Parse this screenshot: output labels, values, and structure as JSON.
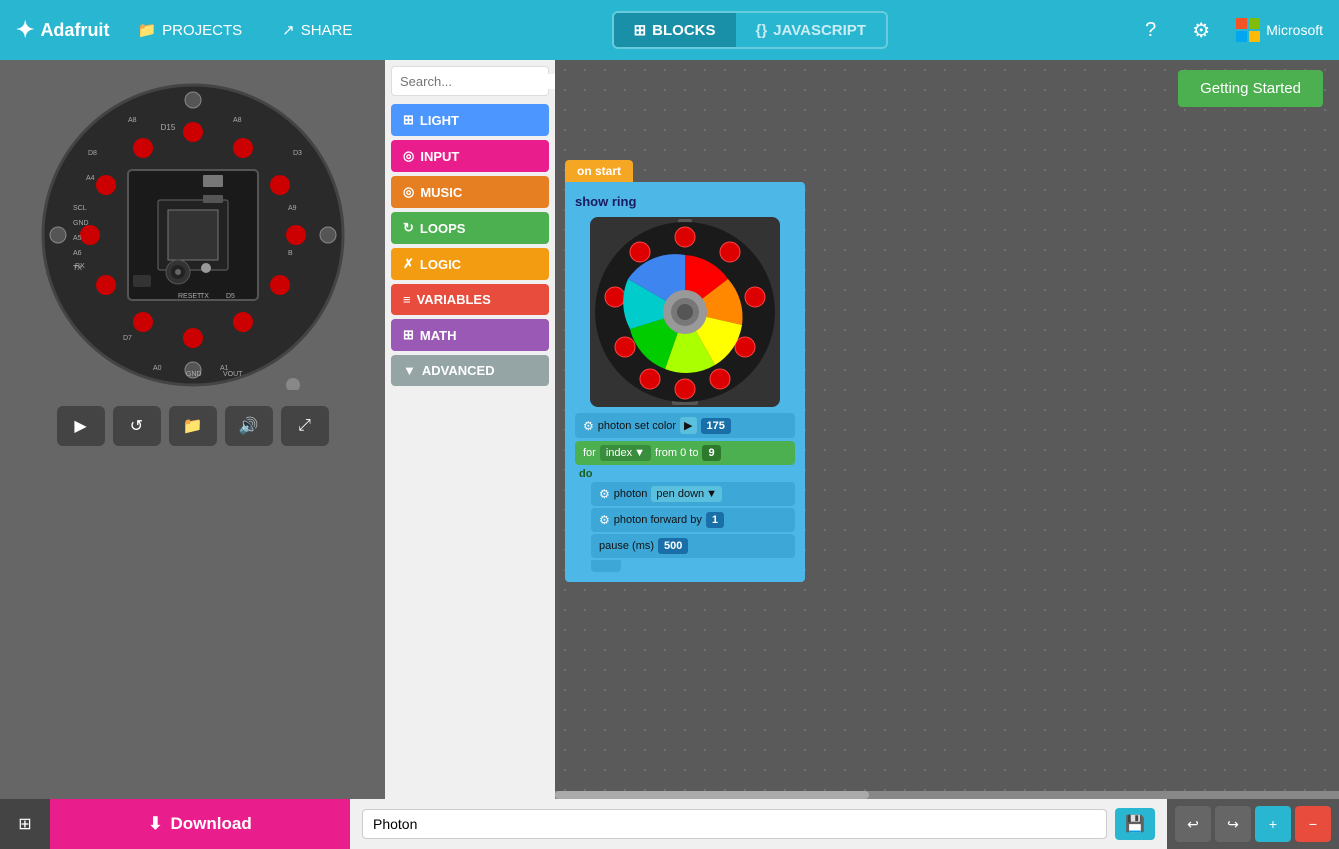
{
  "app": {
    "title": "Adafruit"
  },
  "nav": {
    "logo_text": "adafruit",
    "projects_label": "PROJECTS",
    "share_label": "SHARE",
    "blocks_tab": "BLOCKS",
    "javascript_tab": "JAVASCRIPT",
    "getting_started": "Getting Started"
  },
  "sidebar": {
    "search_placeholder": "Search...",
    "categories": [
      {
        "id": "light",
        "label": "LIGHT",
        "color": "#4c97ff"
      },
      {
        "id": "input",
        "label": "INPUT",
        "color": "#e91e8c"
      },
      {
        "id": "music",
        "label": "MUSIC",
        "color": "#e67e22"
      },
      {
        "id": "loops",
        "label": "LOOPS",
        "color": "#4caf50"
      },
      {
        "id": "logic",
        "label": "LOGIC",
        "color": "#f39c12"
      },
      {
        "id": "variables",
        "label": "VARIABLES",
        "color": "#e74c3c"
      },
      {
        "id": "math",
        "label": "MATH",
        "color": "#9b59b6"
      },
      {
        "id": "advanced",
        "label": "ADVANCED",
        "color": "#95a5a6"
      }
    ]
  },
  "blocks": {
    "on_start_label": "on start",
    "show_ring_label": "show ring",
    "photon_set_color_label": "photon set color",
    "photon_set_color_value": "175",
    "for_label": "for",
    "for_var": "index",
    "for_from": "from 0 to",
    "for_to_value": "9",
    "do_label": "do",
    "photon_pen_down": "photon pen down",
    "photon_pen_down_option": "pen down",
    "photon_forward_label": "photon forward by",
    "photon_forward_value": "1",
    "pause_label": "pause (ms)",
    "pause_value": "500"
  },
  "bottom": {
    "download_label": "Download",
    "filename_value": "Photon",
    "filename_placeholder": "Photon"
  },
  "device_controls": [
    {
      "id": "play",
      "icon": "▶"
    },
    {
      "id": "restart",
      "icon": "↺"
    },
    {
      "id": "folder",
      "icon": "📁"
    },
    {
      "id": "sound",
      "icon": "🔊"
    },
    {
      "id": "expand",
      "icon": "⤢"
    }
  ]
}
